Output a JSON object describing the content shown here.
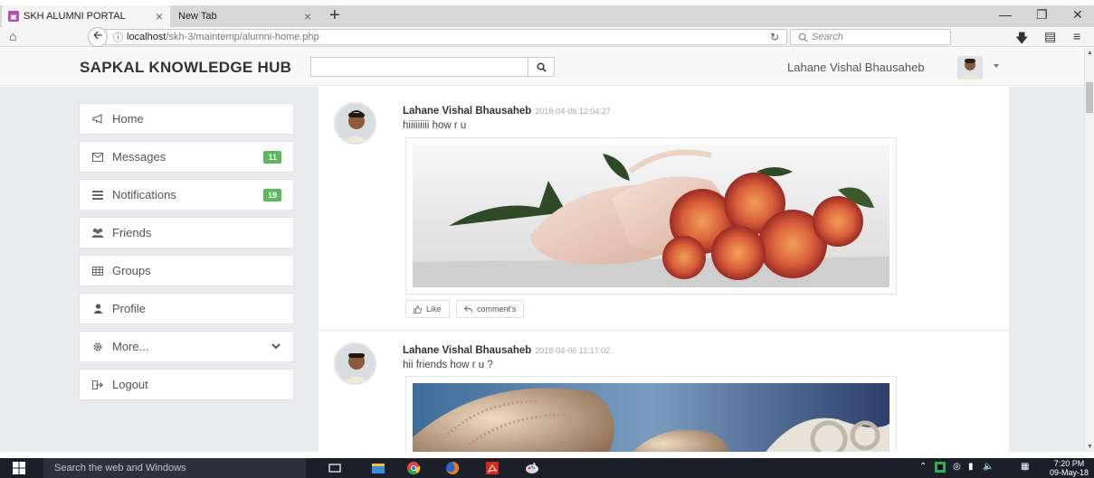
{
  "browser": {
    "tabs": [
      {
        "label": "SKH ALUMNI PORTAL",
        "favicon": "portal-icon",
        "active": true
      },
      {
        "label": "New Tab",
        "active": false
      }
    ],
    "url_host": "localhost",
    "url_path": "/skh-3/maintemp/alumni-home.php",
    "search_placeholder": "Search"
  },
  "header": {
    "brand": "SAPKAL KNOWLEDGE HUB",
    "search_value": "",
    "user_name": "Lahane Vishal Bhausaheb"
  },
  "sidebar": {
    "items": [
      {
        "label": "Home",
        "icon": "bullhorn-icon"
      },
      {
        "label": "Messages",
        "icon": "envelope-icon",
        "badge": "11"
      },
      {
        "label": "Notifications",
        "icon": "list-icon",
        "badge": "19"
      },
      {
        "label": "Friends",
        "icon": "users-icon"
      },
      {
        "label": "Groups",
        "icon": "table-icon"
      },
      {
        "label": "Profile",
        "icon": "user-icon"
      },
      {
        "label": "More...",
        "icon": "cog-icon"
      },
      {
        "label": "Logout",
        "icon": "sign-out-icon"
      }
    ]
  },
  "feed": {
    "posts": [
      {
        "author": "Lahane Vishal Bhausaheb",
        "time": "2018-04-06 12:04:27",
        "text": "hiiiiiiiii how r u",
        "image": "ballet-shoes-roses-image",
        "like_label": "Like",
        "comment_label": "comment's"
      },
      {
        "author": "Lahane Vishal Bhausaheb",
        "time": "2018-04-06 11:17:02",
        "text": "hii friends how r u ?",
        "image": "fractal-art-image"
      }
    ]
  },
  "taskbar": {
    "search_placeholder": "Search the web and Windows",
    "time": "7:20 PM",
    "date": "09-May-18"
  },
  "colors": {
    "badge": "#5cb85c",
    "page_bg": "#e9ebee",
    "taskbar": "#1b1f2a",
    "favicon": "#b04fb0"
  }
}
